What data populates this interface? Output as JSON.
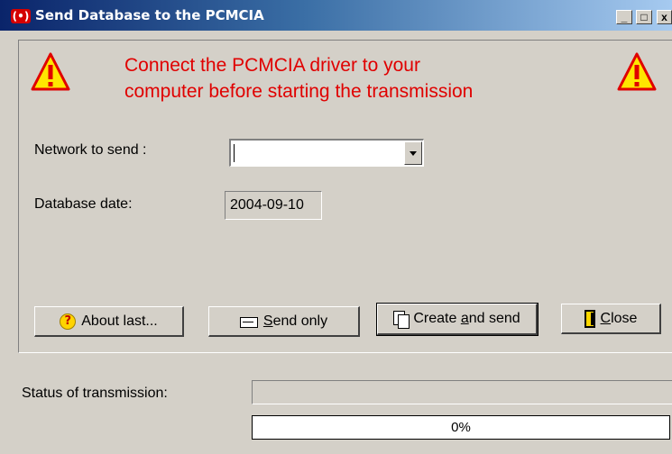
{
  "window": {
    "title": "Send Database to the PCMCIA",
    "app_icon_text": "(•)",
    "minimize_glyph": "_",
    "maximize_glyph": "□",
    "close_glyph": "x",
    "title_color": "#0a246a"
  },
  "warning": {
    "line1": "Connect the PCMCIA driver to your",
    "line2": "computer before starting the transmission",
    "text_color": "#e00000",
    "icon": "warning-triangle-icon"
  },
  "form": {
    "network_label": "Network to send :",
    "network_value": "",
    "database_date_label": "Database date:",
    "database_date_value": "2004-09-10"
  },
  "buttons": {
    "about_icon": "?",
    "about_label": "About last...",
    "send_only_prefix": "",
    "send_only_mnemonic": "S",
    "send_only_rest": "end only",
    "create_prefix": "Create ",
    "create_mnemonic": "a",
    "create_rest": "nd send",
    "close_prefix": "",
    "close_mnemonic": "C",
    "close_rest": "lose"
  },
  "status": {
    "label": "Status of transmission:",
    "text": "",
    "progress_percent": 0,
    "progress_text": "0%"
  }
}
